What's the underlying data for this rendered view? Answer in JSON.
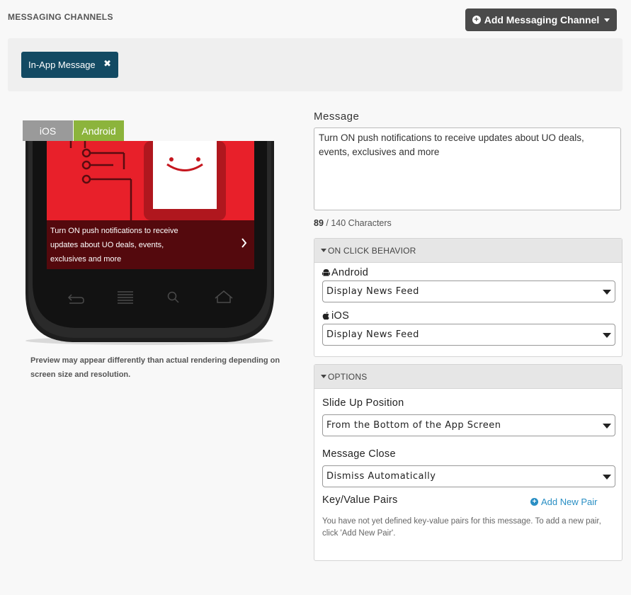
{
  "header": {
    "title": "MESSAGING CHANNELS",
    "add_channel_label": "Add Messaging Channel"
  },
  "channel_tag": {
    "label": "In-App Message",
    "close_symbol": "✖"
  },
  "preview": {
    "tabs": [
      {
        "label": "iOS",
        "active": false,
        "color": "#9a9a9a"
      },
      {
        "label": "Android",
        "active": true,
        "color": "#8cb43c"
      }
    ],
    "message_text_lines": [
      "Turn ON push notifications to receive",
      "updates about UO deals, events,",
      "exclusives and more"
    ],
    "note": "Preview may appear differently than actual rendering depending on screen size and resolution.",
    "accent_color": "#e8202a"
  },
  "message": {
    "label": "Message",
    "value": "Turn ON push notifications to receive updates about UO deals, events, exclusives and more",
    "count": "89",
    "limit_text": "/ 140 Characters"
  },
  "on_click": {
    "header": "ON CLICK BEHAVIOR",
    "android_label": "Android",
    "android_value": "Display News Feed",
    "ios_label": "iOS",
    "ios_value": "Display News Feed"
  },
  "options": {
    "header": "OPTIONS",
    "slide_up_label": "Slide Up Position",
    "slide_up_value": "From the Bottom of the App Screen",
    "close_label": "Message Close",
    "close_value": "Dismiss Automatically",
    "kv_label": "Key/Value Pairs",
    "add_pair_label": "Add New Pair",
    "kv_note": "You have not yet defined key-value pairs for this message. To add a new pair, click 'Add New Pair'."
  },
  "colors": {
    "tag_bg": "#134a63",
    "button_dark": "#4a4a4a",
    "link_blue": "#2a8fc4"
  }
}
